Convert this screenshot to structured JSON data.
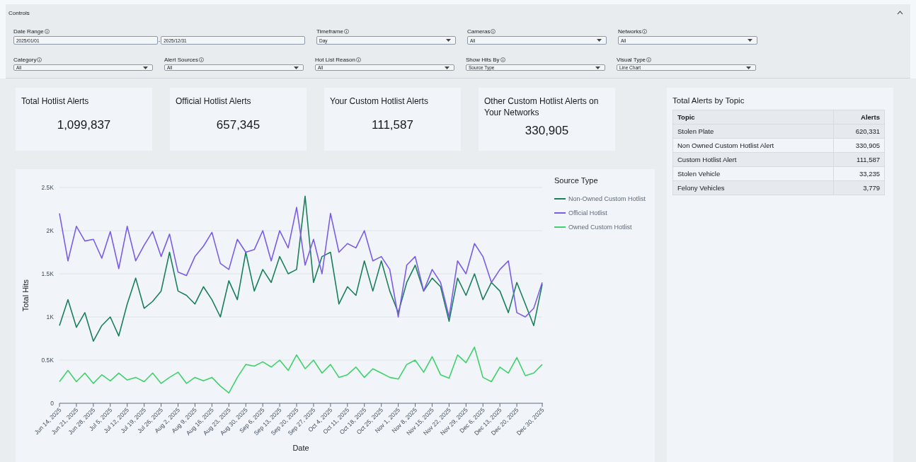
{
  "controls": {
    "title": "Controls",
    "expanded": true,
    "filters": [
      {
        "kind": "date_range",
        "label": "Date Range",
        "from": "2025/01/01",
        "separator": "-",
        "to": "2025/12/31"
      },
      {
        "kind": "select",
        "label": "Timeframe",
        "value": "Day"
      },
      {
        "kind": "select",
        "label": "Cameras",
        "value": "All"
      },
      {
        "kind": "select",
        "label": "Networks",
        "value": "All"
      },
      {
        "kind": "select",
        "label": "Category",
        "value": "All"
      },
      {
        "kind": "select",
        "label": "Alert Sources",
        "value": "All"
      },
      {
        "kind": "select",
        "label": "Hot List Reason",
        "value": "All"
      },
      {
        "kind": "select",
        "label": "Show Hits By",
        "value": "Source Type"
      },
      {
        "kind": "select",
        "label": "Visual Type",
        "value": "Line Chart"
      }
    ]
  },
  "kpis": [
    {
      "title": "Total Hotlist Alerts",
      "value": "1,099,837"
    },
    {
      "title": "Official Hotlist Alerts",
      "value": "657,345"
    },
    {
      "title": "Your Custom Hotlist Alerts",
      "value": "111,587"
    },
    {
      "title": "Other Custom Hotlist Alerts on Your Networks",
      "value": "330,905"
    }
  ],
  "chart": {
    "chart_data": {
      "type": "line",
      "xlabel": "Date",
      "ylabel": "Total Hits",
      "legend_title": "Source Type",
      "legend": "right",
      "grid": true,
      "ylim": [
        0,
        2500
      ],
      "yticks": [
        {
          "value": 0,
          "label": "0"
        },
        {
          "value": 500,
          "label": "0.5K"
        },
        {
          "value": 1000,
          "label": "1K"
        },
        {
          "value": 1500,
          "label": "1.5K"
        },
        {
          "value": 2000,
          "label": "2K"
        },
        {
          "value": 2500,
          "label": "2.5K"
        }
      ],
      "categories": [
        "Jun 14, 2025",
        null,
        "Jun 21, 2025",
        null,
        "Jun 28, 2025",
        null,
        "Jul 5, 2025",
        null,
        "Jul 12, 2025",
        null,
        "Jul 19, 2025",
        null,
        "Jul 26, 2025",
        null,
        "Aug 2, 2025",
        null,
        "Aug 9, 2025",
        null,
        "Aug 16, 2025",
        null,
        "Aug 23, 2025",
        null,
        "Aug 30, 2025",
        null,
        "Sep 6, 2025",
        null,
        "Sep 13, 2025",
        null,
        "Sep 20, 2025",
        null,
        "Sep 27, 2025",
        null,
        "Oct 4, 2025",
        null,
        "Oct 11, 2025",
        null,
        "Oct 18, 2025",
        null,
        "Oct 25, 2025",
        null,
        "Nov 1, 2025",
        null,
        "Nov 8, 2025",
        null,
        "Nov 15, 2025",
        null,
        "Nov 22, 2025",
        null,
        "Nov 29, 2025",
        null,
        "Dec 6, 2025",
        null,
        "Dec 13, 2025",
        null,
        "Dec 20, 2025",
        null,
        null,
        "Dec 30, 2025"
      ],
      "series": [
        {
          "name": "Non-Owned Custom Hotlist",
          "color": "#1a7f5a",
          "values": [
            900,
            1200,
            880,
            1050,
            720,
            900,
            1000,
            780,
            1150,
            1450,
            1100,
            1180,
            1300,
            1750,
            1300,
            1250,
            1150,
            1350,
            1200,
            1000,
            1420,
            1200,
            1750,
            1300,
            1550,
            1400,
            1700,
            1500,
            1550,
            2400,
            1400,
            1700,
            1750,
            1150,
            1350,
            1250,
            1650,
            1300,
            1650,
            1300,
            1050,
            1400,
            1600,
            1300,
            1450,
            1350,
            950,
            1450,
            1250,
            1500,
            1200,
            1400,
            1300,
            1050,
            1400,
            1150,
            900,
            1380
          ]
        },
        {
          "name": "Official Hotlist",
          "color": "#7b5ce6",
          "values": [
            2200,
            1650,
            2050,
            1880,
            1900,
            1680,
            1990,
            1560,
            2050,
            1650,
            1830,
            1990,
            1700,
            1960,
            1520,
            1480,
            1700,
            1820,
            1980,
            1620,
            1550,
            1900,
            1750,
            1780,
            2000,
            1650,
            2000,
            1800,
            2270,
            1600,
            1900,
            1500,
            2200,
            1750,
            1850,
            1800,
            2000,
            1650,
            1700,
            1550,
            1000,
            1600,
            1700,
            1300,
            1550,
            1400,
            1000,
            1650,
            1500,
            1850,
            1700,
            1400,
            1550,
            1650,
            1050,
            1000,
            1100,
            1400
          ]
        },
        {
          "name": "Owned Custom Hotlist",
          "color": "#3fd16a",
          "values": [
            250,
            380,
            250,
            350,
            230,
            330,
            260,
            350,
            270,
            300,
            250,
            350,
            230,
            300,
            360,
            230,
            300,
            260,
            300,
            200,
            120,
            300,
            450,
            430,
            480,
            420,
            500,
            380,
            560,
            400,
            500,
            350,
            450,
            300,
            330,
            420,
            300,
            400,
            350,
            300,
            280,
            450,
            500,
            360,
            540,
            330,
            290,
            560,
            470,
            650,
            300,
            250,
            420,
            350,
            530,
            320,
            350,
            450
          ]
        }
      ]
    }
  },
  "topic_table": {
    "title": "Total Alerts by Topic",
    "columns": [
      "Topic",
      "Alerts"
    ],
    "rows": [
      [
        "Stolen Plate",
        "620,331"
      ],
      [
        "Non Owned Custom Hotlist Alert",
        "330,905"
      ],
      [
        "Custom Hotlist Alert",
        "111,587"
      ],
      [
        "Stolen Vehicle",
        "33,235"
      ],
      [
        "Felony Vehicles",
        "3,779"
      ]
    ]
  }
}
